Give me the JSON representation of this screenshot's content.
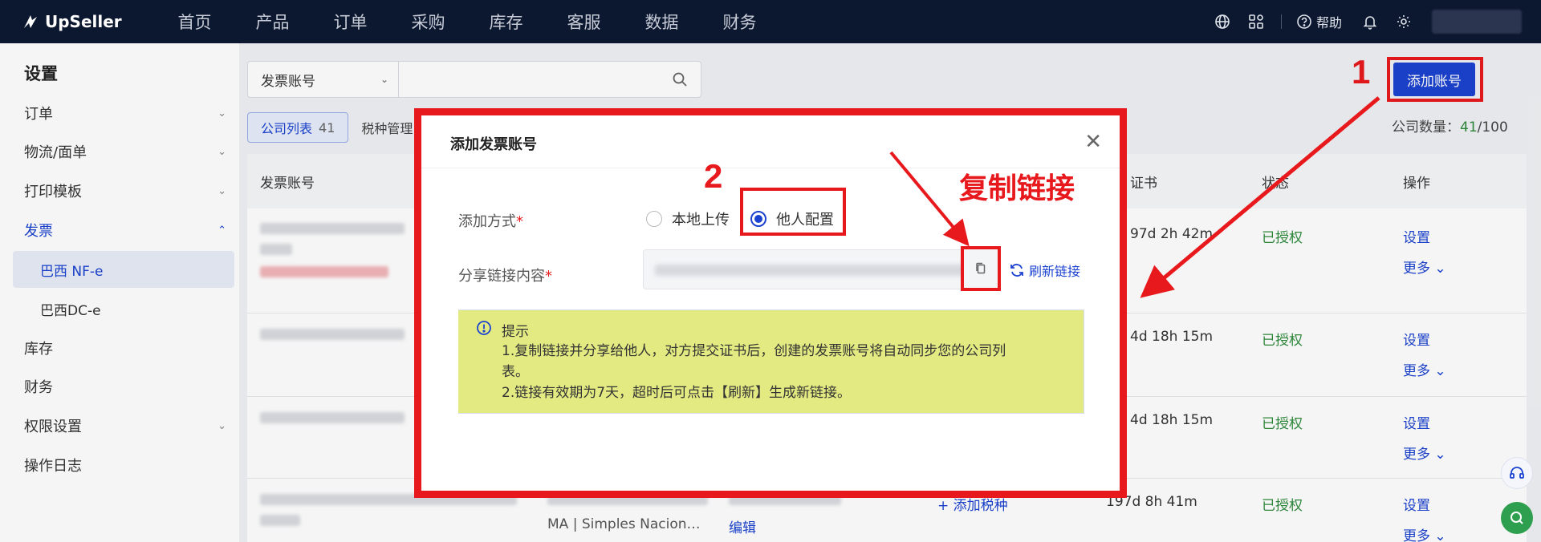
{
  "app": {
    "logo": "UpSeller"
  },
  "nav": [
    "首页",
    "产品",
    "订单",
    "采购",
    "库存",
    "客服",
    "数据",
    "财务"
  ],
  "topright": {
    "help": "帮助"
  },
  "sidebar": {
    "title": "设置",
    "items": [
      {
        "label": "订单",
        "chev": "⌄"
      },
      {
        "label": "物流/面单",
        "chev": "⌄"
      },
      {
        "label": "打印模板",
        "chev": "⌄"
      },
      {
        "label": "发票",
        "chev": "⌃"
      },
      {
        "label": "巴西 NF-e"
      },
      {
        "label": "巴西DC-e"
      },
      {
        "label": "库存"
      },
      {
        "label": "财务"
      },
      {
        "label": "权限设置",
        "chev": "⌄"
      },
      {
        "label": "操作日志"
      }
    ]
  },
  "search": {
    "select_label": "发票账号"
  },
  "tabs": {
    "company_list": "公司列表",
    "company_count": "41",
    "tax_mgmt": "税种管理"
  },
  "toolbar": {
    "add_account": "添加账号",
    "count_prefix": "公司数量：",
    "count_value": "41",
    "count_total": "/100"
  },
  "table": {
    "headers": {
      "account": "发票账号",
      "cert": "证书",
      "status": "状态",
      "ops": "操作"
    },
    "rows": [
      {
        "cert": "97d 2h 42m",
        "status": "已授权",
        "set": "设置",
        "more": "更多 ⌄"
      },
      {
        "cert": "4d 18h 15m",
        "status": "已授权",
        "set": "设置",
        "more": "更多 ⌄"
      },
      {
        "cert": "4d 18h 15m",
        "status": "已授权",
        "set": "设置",
        "more": "更多 ⌄"
      },
      {
        "cert": "197d 8h 41m",
        "status": "已授权",
        "set": "设置",
        "more": "更多 ⌄",
        "add_tax": "+ 添加税种",
        "desc": "MA | Simples Nacion…",
        "edit": "编辑"
      }
    ]
  },
  "modal": {
    "title": "添加发票账号",
    "method_label": "添加方式",
    "option_local": "本地上传",
    "option_other": "他人配置",
    "share_label": "分享链接内容",
    "refresh": "刷新链接",
    "tip_title": "提示",
    "tip_line1": "1.复制链接并分享给他人，对方提交证书后，创建的发票账号将自动同步您的公司列",
    "tip_line1b": "表。",
    "tip_line2": "2.链接有效期为7天，超时后可点击【刷新】生成新链接。"
  },
  "annotations": {
    "step1": "1",
    "step2": "2",
    "copy_link": "复制链接"
  }
}
